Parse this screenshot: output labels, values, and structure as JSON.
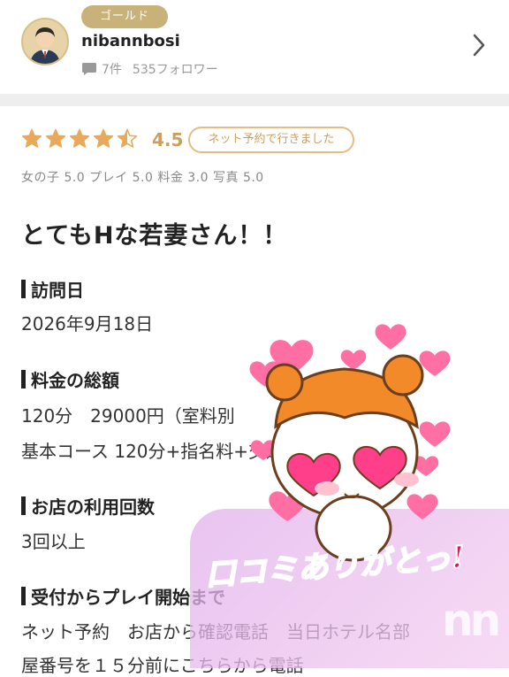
{
  "header": {
    "badge": "ゴールド",
    "username": "nibannbosi",
    "review_count": "7件",
    "followers": "535フォロワー"
  },
  "review": {
    "rating": "4.5",
    "stars_value": 4.5,
    "reserve_badge": "ネット予約で行きました",
    "subscores": "女の子 5.0 プレイ 5.0 料金 3.0 写真 5.0",
    "title": "とてもHな若妻さん！！",
    "sections": [
      {
        "heading": "訪問日",
        "lines": [
          "2026年9月18日"
        ]
      },
      {
        "heading": "料金の総額",
        "lines": [
          "120分　29000円（室料別",
          "基本コース 120分+指名料+交通"
        ]
      },
      {
        "heading": "お店の利用回数",
        "lines": [
          "3回以上"
        ]
      },
      {
        "heading": "受付からプレイ開始まで",
        "lines": [
          "ネット予約　お店から確認電話　当日ホテル名部",
          "屋番号を１５分前にこちらから電話"
        ]
      }
    ]
  },
  "sticker": {
    "text": "口コミありがとっ!",
    "watermark": "nn"
  },
  "colors": {
    "star": "#e8a95a",
    "accent_gold": "#c9a060",
    "badge_bg": "#c8b27a",
    "heart": "#ff6fa3",
    "sticker_text": "#e4106a"
  }
}
